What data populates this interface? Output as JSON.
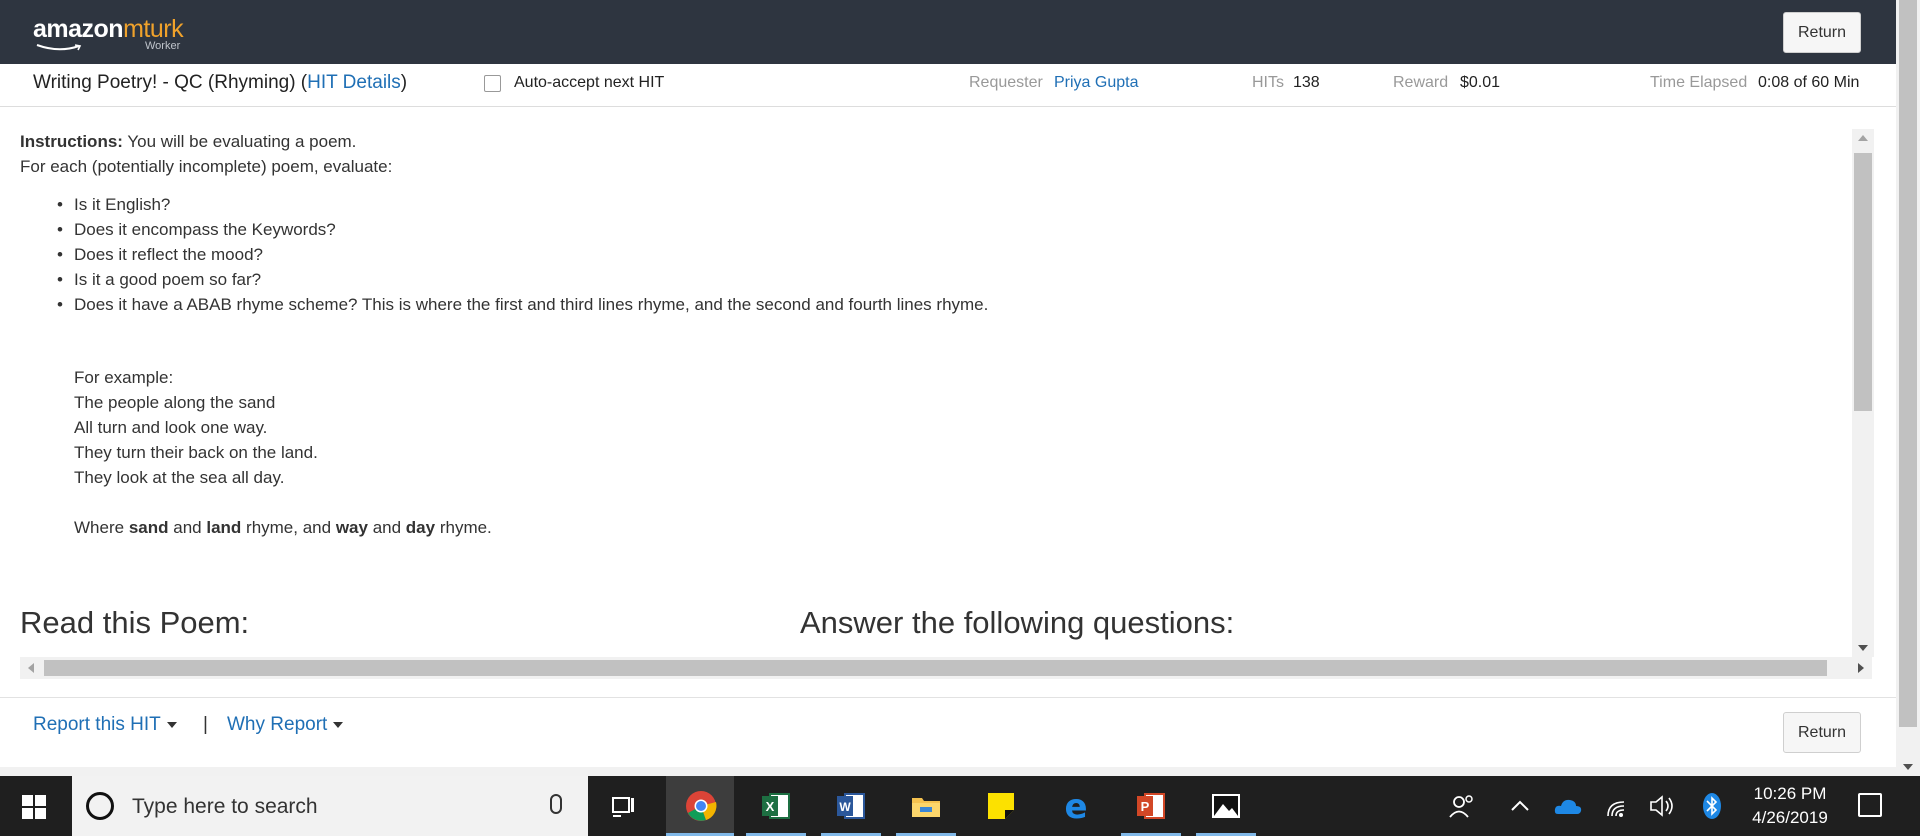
{
  "header": {
    "brand_amazon": "amazon",
    "brand_mturk": "mturk",
    "brand_worker": "Worker",
    "return_label": "Return"
  },
  "hit_bar": {
    "title": "Writing Poetry! - QC (Rhyming)",
    "details_link": "HIT Details",
    "auto_accept_label": "Auto-accept next HIT",
    "requester_label": "Requester",
    "requester_name": "Priya Gupta",
    "hits_label": "HITs",
    "hits_value": "138",
    "reward_label": "Reward",
    "reward_value": "$0.01",
    "time_label": "Time Elapsed",
    "time_value": "0:08 of 60 Min"
  },
  "instructions": {
    "heading": "Instructions:",
    "line1": "You will be evaluating a poem.",
    "line2": "For each (potentially incomplete) poem, evaluate:",
    "bullets": [
      "Is it English?",
      "Does it encompass the Keywords?",
      "Does it reflect the mood?",
      "Is it a good poem so far?",
      "Does it have a ABAB rhyme scheme? This is where the first and third lines rhyme, and the second and fourth lines rhyme."
    ],
    "example_heading": "For example:",
    "example_lines": [
      "The people along the sand",
      "All turn and look one way.",
      "They turn their back on the land.",
      "They look at the sea all day."
    ],
    "rhyme_note": {
      "where": "Where",
      "w1": "sand",
      "and1": "and",
      "w2": "land",
      "mid": "rhyme, and",
      "w3": "way",
      "and2": "and",
      "w4": "day",
      "end": "rhyme."
    }
  },
  "sections": {
    "poem_heading": "Read this Poem:",
    "questions_heading": "Answer the following questions:"
  },
  "footer": {
    "report_hit": "Report this HIT",
    "separator": "|",
    "why_report": "Why Report",
    "return_label": "Return"
  },
  "taskbar": {
    "search_placeholder": "Type here to search",
    "time": "10:26 PM",
    "date": "4/26/2019",
    "icons": [
      "windows-start-icon",
      "cortana-icon",
      "microphone-icon",
      "task-view-icon",
      "chrome-icon",
      "excel-icon",
      "word-icon",
      "file-explorer-icon",
      "sticky-notes-icon",
      "edge-icon",
      "powerpoint-icon",
      "photos-icon",
      "people-icon",
      "chevron-up-icon",
      "onedrive-icon",
      "wifi-icon",
      "volume-icon",
      "bluetooth-icon",
      "notification-icon"
    ]
  },
  "colors": {
    "navbar": "#2e3540",
    "mturk_orange": "#f0a22b",
    "link_blue": "#1f6fb5",
    "taskbar": "#1f1f1f"
  }
}
